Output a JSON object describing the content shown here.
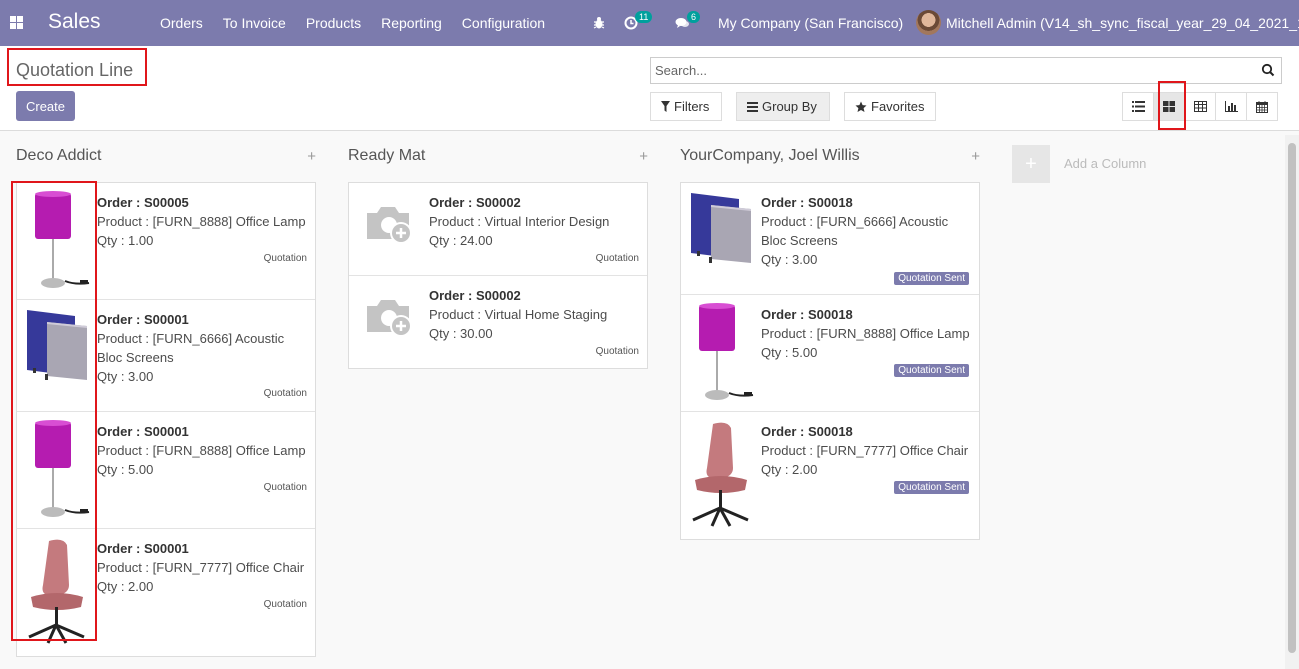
{
  "app": {
    "name": "Sales"
  },
  "menu": [
    "Orders",
    "To Invoice",
    "Products",
    "Reporting",
    "Configuration"
  ],
  "systray": {
    "activity_count": "11",
    "message_count": "6",
    "company": "My Company (San Francisco)",
    "user": "Mitchell Admin (V14_sh_sync_fiscal_year_29_04_2021_1)"
  },
  "breadcrumb": "Quotation Line",
  "create_label": "Create",
  "search": {
    "placeholder": "Search..."
  },
  "filters": {
    "filters_label": "Filters",
    "groupby_label": "Group By",
    "favorites_label": "Favorites"
  },
  "views": [
    "list-view-icon",
    "kanban-view-icon",
    "pivot-view-icon",
    "graph-view-icon",
    "calendar-view-icon"
  ],
  "active_view": "kanban",
  "add_column_label": "Add a Column",
  "colors": {
    "brand": "#7c7bad",
    "highlight": "#e0161b",
    "badge": "#00a09d"
  },
  "columns": [
    {
      "title": "Deco Addict",
      "cards": [
        {
          "order": "Order : S00005",
          "product": "Product : [FURN_8888] Office Lamp",
          "qty": "Qty : 1.00",
          "state": "Quotation",
          "image": "lamp"
        },
        {
          "order": "Order : S00001",
          "product": "Product : [FURN_6666] Acoustic Bloc Screens",
          "qty": "Qty : 3.00",
          "state": "Quotation",
          "image": "screens"
        },
        {
          "order": "Order : S00001",
          "product": "Product : [FURN_8888] Office Lamp",
          "qty": "Qty : 5.00",
          "state": "Quotation",
          "image": "lamp"
        },
        {
          "order": "Order : S00001",
          "product": "Product : [FURN_7777] Office Chair",
          "qty": "Qty : 2.00",
          "state": "Quotation",
          "image": "chair"
        }
      ]
    },
    {
      "title": "Ready Mat",
      "cards": [
        {
          "order": "Order : S00002",
          "product": "Product : Virtual Interior Design",
          "qty": "Qty : 24.00",
          "state": "Quotation",
          "image": "placeholder"
        },
        {
          "order": "Order : S00002",
          "product": "Product : Virtual Home Staging",
          "qty": "Qty : 30.00",
          "state": "Quotation",
          "image": "placeholder"
        }
      ]
    },
    {
      "title": "YourCompany, Joel Willis",
      "cards": [
        {
          "order": "Order : S00018",
          "product": "Product : [FURN_6666] Acoustic Bloc Screens",
          "qty": "Qty : 3.00",
          "state": "Quotation Sent",
          "image": "screens"
        },
        {
          "order": "Order : S00018",
          "product": "Product : [FURN_8888] Office Lamp",
          "qty": "Qty : 5.00",
          "state": "Quotation Sent",
          "image": "lamp"
        },
        {
          "order": "Order : S00018",
          "product": "Product : [FURN_7777] Office Chair",
          "qty": "Qty : 2.00",
          "state": "Quotation Sent",
          "image": "chair"
        }
      ]
    }
  ]
}
